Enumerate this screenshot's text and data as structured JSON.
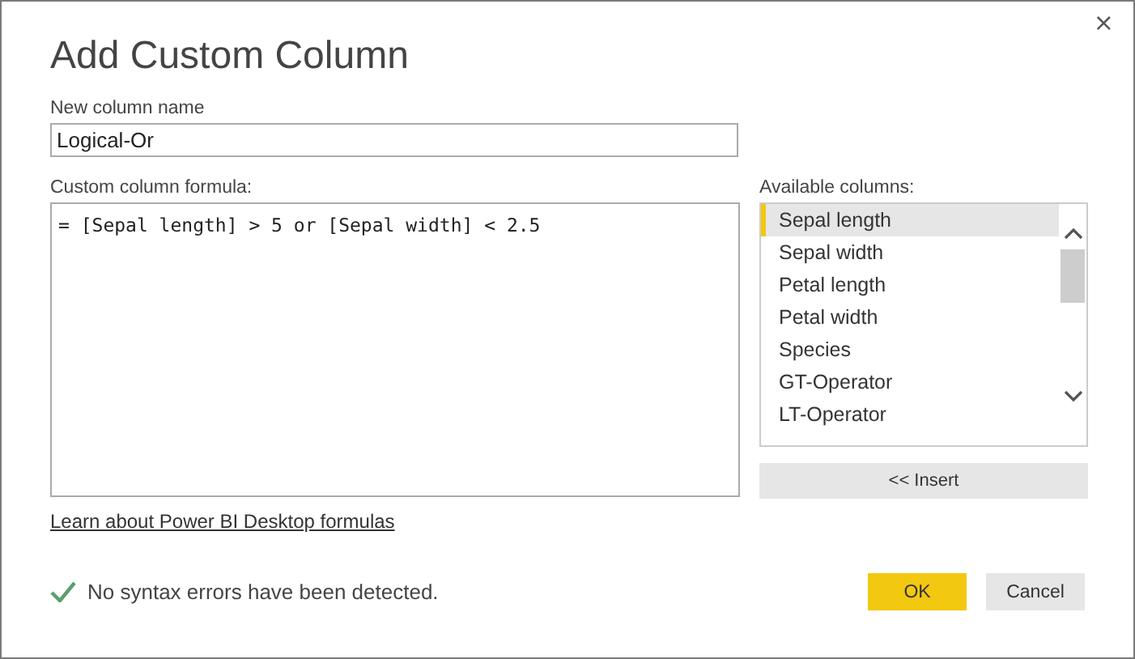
{
  "window": {
    "title": "Add Custom Column",
    "close": "×"
  },
  "name_field": {
    "label": "New column name",
    "value": "Logical-Or"
  },
  "formula_field": {
    "label": "Custom column formula:",
    "value": "= [Sepal length] > 5 or [Sepal width] < 2.5"
  },
  "available_columns": {
    "label": "Available columns:",
    "items": [
      {
        "label": "Sepal length",
        "selected": true
      },
      {
        "label": "Sepal width",
        "selected": false
      },
      {
        "label": "Petal length",
        "selected": false
      },
      {
        "label": "Petal width",
        "selected": false
      },
      {
        "label": "Species",
        "selected": false
      },
      {
        "label": "GT-Operator",
        "selected": false
      },
      {
        "label": "LT-Operator",
        "selected": false
      }
    ],
    "insert_button": "<< Insert"
  },
  "link": "Learn about Power BI Desktop formulas",
  "status": {
    "ok": true,
    "message": "No syntax errors have been detected."
  },
  "buttons": [
    {
      "label": "OK",
      "kind": "primary"
    },
    {
      "label": "Cancel",
      "kind": "secondary"
    }
  ]
}
